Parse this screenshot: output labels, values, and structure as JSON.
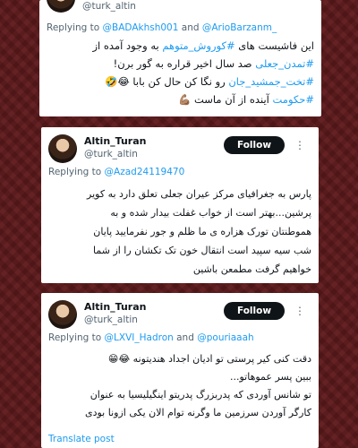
{
  "tweets": [
    {
      "handle": "@turk_altin",
      "reply_prefix": "Replying to",
      "mentions": [
        "@BADAkhsh001",
        "@ArioBarzanm_"
      ],
      "and": "and",
      "lines": [
        {
          "parts": [
            {
              "t": "این فاشیست های ",
              "h": false
            },
            {
              "t": "#کوروش_متوهم",
              "h": true
            },
            {
              "t": " به وجود آمده از",
              "h": false
            }
          ]
        },
        {
          "parts": [
            {
              "t": "#تمدن_جعلی",
              "h": true
            },
            {
              "t": " صد سال اخیر قراره به گور برن!",
              "h": false
            }
          ]
        },
        {
          "parts": [
            {
              "t": "#تخت_جمشید_جان",
              "h": true
            },
            {
              "t": " رو نگا کن حال کن بابا 😂🤣",
              "h": false
            }
          ]
        },
        {
          "parts": [
            {
              "t": "#حکومت",
              "h": true
            },
            {
              "t": " آینده از آن ماست 💪🏽",
              "h": false
            }
          ]
        }
      ]
    },
    {
      "name": "Altin_Turan",
      "handle": "@turk_altin",
      "follow_label": "Follow",
      "reply_prefix": "Replying to",
      "mentions": [
        "@Azad24119470"
      ],
      "lines": [
        "پارس به جغرافیای مرکز عیران جعلی تعلق دارد به کویر",
        "پرشین...بهتر است از خواب غفلت بیدار شده و به",
        "هموطنتان تورک هزاره ی ما ظلم و جور نفرمایید پایان",
        "شب سیه سپید است انتقال خون تک تکشان را از شما",
        "خواهیم گرفت مطمعن باشین"
      ]
    },
    {
      "name": "Altin_Turan",
      "handle": "@turk_altin",
      "follow_label": "Follow",
      "reply_prefix": "Replying to",
      "mentions": [
        "@LXVI_Hadron",
        "@pouriaaah"
      ],
      "and": "and",
      "lines": [
        "دقت کنی کیر پرستی تو ادیان اجداد هندیتونه 😂😁",
        "ببین پسر عموهاتو...",
        "تو شانس آوردی که پدربزرگ پدریتو اینگیلیسیا به عنوان",
        "کارگر آوردن سرزمین ما وگرنه توام الان یکی ازونا بودی"
      ],
      "translate_label": "Translate post"
    }
  ],
  "colors": {
    "background": "#5e1a1c",
    "link": "#1d9bf0",
    "text": "#0f1419",
    "muted": "#536471"
  },
  "icons": {
    "more": "more-horizontal-icon"
  }
}
